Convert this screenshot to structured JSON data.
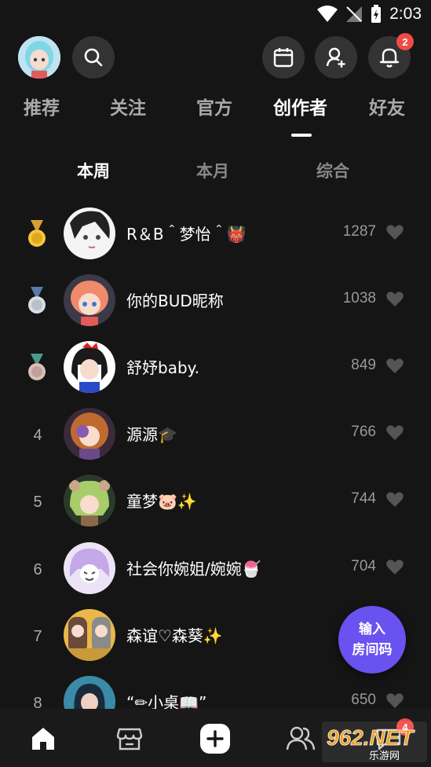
{
  "status": {
    "time": "2:03"
  },
  "header": {
    "notification_badge": "2"
  },
  "tabs": [
    {
      "label": "推荐",
      "active": false
    },
    {
      "label": "关注",
      "active": false
    },
    {
      "label": "官方",
      "active": false
    },
    {
      "label": "创作者",
      "active": true
    },
    {
      "label": "好友",
      "active": false
    }
  ],
  "subtabs": [
    {
      "label": "本周",
      "active": true
    },
    {
      "label": "本月",
      "active": false
    },
    {
      "label": "综合",
      "active": false
    }
  ],
  "ranking": [
    {
      "rank": "",
      "medal": "gold",
      "name": "R＆B＾梦怡＾👹",
      "likes": "1287",
      "avatar_color": "#f0f0f0"
    },
    {
      "rank": "",
      "medal": "silver",
      "name": "你的BUD昵称",
      "likes": "1038",
      "avatar_color": "#e87a5a"
    },
    {
      "rank": "",
      "medal": "bronze",
      "name": "舒妤baby.",
      "likes": "849",
      "avatar_color": "#2a1a1a"
    },
    {
      "rank": "4",
      "medal": "",
      "name": "源源🎓",
      "likes": "766",
      "avatar_color": "#b86a3a"
    },
    {
      "rank": "5",
      "medal": "",
      "name": "童梦🐷✨",
      "likes": "744",
      "avatar_color": "#a8c96a"
    },
    {
      "rank": "6",
      "medal": "",
      "name": "社会你婉姐/婉婉🍧",
      "likes": "704",
      "avatar_color": "#c9b0e8"
    },
    {
      "rank": "7",
      "medal": "",
      "name": "森谊♡森葵✨",
      "likes": "",
      "avatar_color": "#e8c26a"
    },
    {
      "rank": "8",
      "medal": "",
      "name": "“✏小桌📖”",
      "likes": "650",
      "avatar_color": "#4aa8c0"
    }
  ],
  "fab": {
    "line1": "输入",
    "line2": "房间码"
  },
  "bottom_nav": {
    "messages_badge": "4"
  },
  "watermark": {
    "text": "962.NET",
    "sub": "乐游网"
  },
  "colors": {
    "accent": "#6a52f0",
    "badge": "#f04b47",
    "background": "#151515"
  }
}
